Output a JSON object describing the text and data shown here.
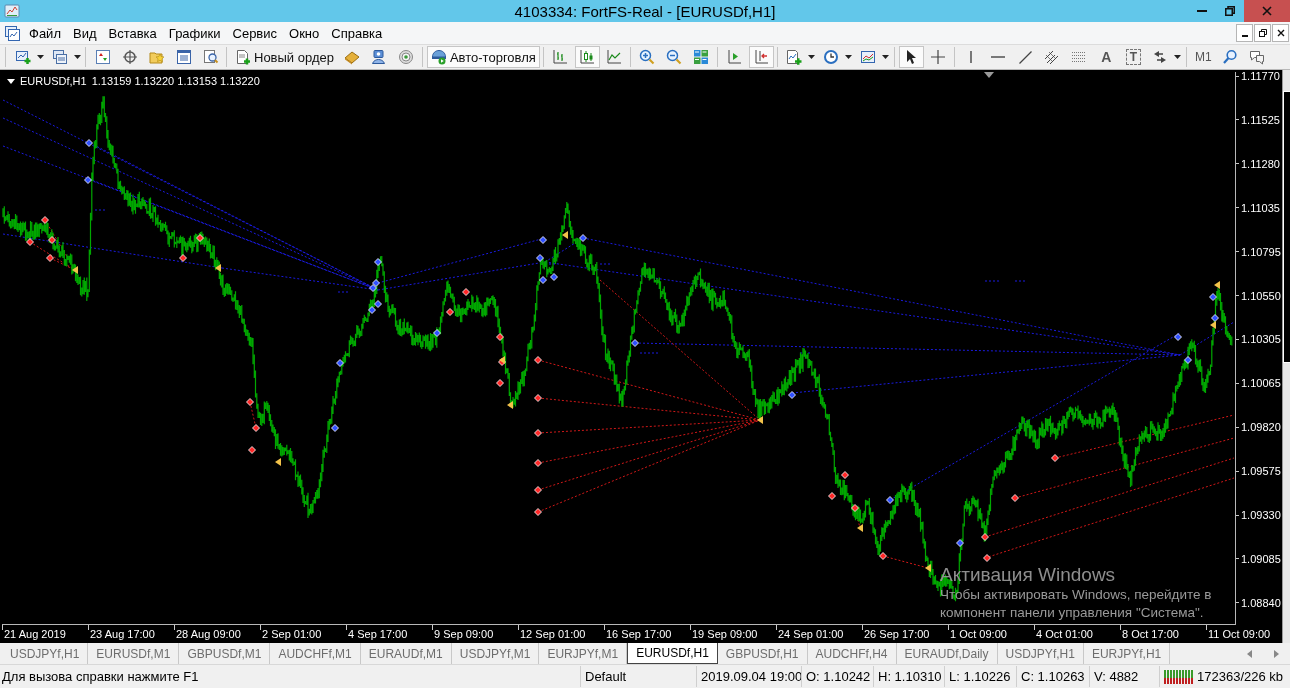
{
  "window": {
    "title": "4103334: FortFS-Real - [EURUSDf,H1]"
  },
  "menu": [
    "Файл",
    "Вид",
    "Вставка",
    "Графики",
    "Сервис",
    "Окно",
    "Справка"
  ],
  "toolbar": {
    "new_order": "Новый ордер",
    "auto_trading": {
      "label": "Авто-торговля",
      "on": true
    },
    "chart_types": [
      {
        "selected": false
      },
      {
        "selected": true
      },
      {
        "selected": false
      }
    ],
    "auto_scroll": {
      "on": false
    },
    "chart_shift": {
      "on": true
    },
    "cursor_modes": [
      {
        "selected": true
      },
      {
        "selected": false
      }
    ],
    "text_tool": "A",
    "label_tool": "T",
    "timeframe": "M1"
  },
  "chart": {
    "symbol": "EURUSDf,H1",
    "quotes": "1.13159 1.13220 1.13153 1.13220",
    "price_labels": [
      "1.11770",
      "1.11525",
      "1.11280",
      "1.11035",
      "1.10795",
      "1.10550",
      "1.10305",
      "1.10065",
      "1.09820",
      "1.09575",
      "1.09330",
      "1.09085",
      "1.08840"
    ],
    "time_labels": [
      "21 Aug 2019",
      "23 Aug 17:00",
      "28 Aug 09:00",
      "2 Sep 01:00",
      "4 Sep 17:00",
      "9 Sep 09:00",
      "12 Sep 01:00",
      "16 Sep 17:00",
      "19 Sep 09:00",
      "24 Sep 01:00",
      "26 Sep 17:00",
      "1 Oct 09:00",
      "4 Oct 01:00",
      "8 Oct 17:00",
      "11 Oct 09:00"
    ]
  },
  "tabs": [
    {
      "label": "USDJPYf,H1",
      "selected": false
    },
    {
      "label": "EURUSDf,M1",
      "selected": false
    },
    {
      "label": "GBPUSDf,M1",
      "selected": false
    },
    {
      "label": "AUDCHFf,M1",
      "selected": false
    },
    {
      "label": "EURAUDf,M1",
      "selected": false
    },
    {
      "label": "USDJPYf,M1",
      "selected": false
    },
    {
      "label": "EURJPYf,M1",
      "selected": false
    },
    {
      "label": "EURUSDf,H1",
      "selected": true
    },
    {
      "label": "GBPUSDf,H1",
      "selected": false
    },
    {
      "label": "AUDCHFf,H4",
      "selected": false
    },
    {
      "label": "EURAUDf,Daily",
      "selected": false
    },
    {
      "label": "USDJPYf,H1",
      "selected": false
    },
    {
      "label": "EURJPYf,H1",
      "selected": false
    }
  ],
  "status_bar": {
    "help": "Для вызова справки нажмите F1",
    "profile": "Default",
    "time": "2019.09.04 19:00",
    "open": "O: 1.10242",
    "high": "H: 1.10310",
    "low": "L: 1.10226",
    "close": "C: 1.10263",
    "volume": "V: 4882",
    "traffic": "172363/226 kb"
  },
  "activation_notice": {
    "title": "Активация Windows",
    "lines": [
      "Чтобы активировать Windows, перейдите в",
      "компонент панели управления \"Система\"."
    ]
  }
}
